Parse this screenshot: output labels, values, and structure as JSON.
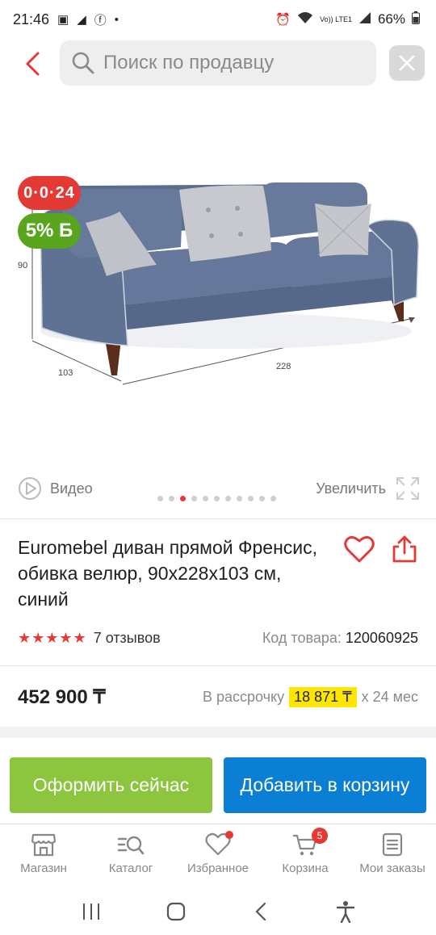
{
  "status": {
    "time": "21:46",
    "battery": "66%",
    "network_label": "Vo)) LTE1"
  },
  "header": {
    "search_placeholder": "Поиск по продавцу"
  },
  "gallery": {
    "badge_installment": "0·0·24",
    "badge_bonus": "5% Б",
    "dim_height": "90",
    "dim_depth": "103",
    "dim_width": "228",
    "video_label": "Видео",
    "zoom_label": "Увеличить",
    "dot_count": 11,
    "active_dot": 2
  },
  "product": {
    "title": "Euromebel диван прямой Френсис, обивка велюр, 90x228x103 см, синий",
    "stars": "★★★★★",
    "reviews": "7 отзывов",
    "sku_label": "Код товара:",
    "sku_value": "120060925",
    "price": "452 900 ₸",
    "installment_label": "В рассрочку",
    "installment_amount": "18 871 ₸",
    "installment_term": "х 24 мес"
  },
  "actions": {
    "checkout": "Оформить сейчас",
    "add_to_cart": "Добавить в корзину"
  },
  "bottom_nav": {
    "items": [
      {
        "label": "Магазин",
        "icon": "shop-icon"
      },
      {
        "label": "Каталог",
        "icon": "catalog-search-icon"
      },
      {
        "label": "Избранное",
        "icon": "heart-icon"
      },
      {
        "label": "Корзина",
        "icon": "cart-icon"
      },
      {
        "label": "Мои заказы",
        "icon": "orders-icon"
      }
    ],
    "cart_count": "5"
  },
  "colors": {
    "accent_red": "#e53935",
    "green": "#8cc63f",
    "blue": "#0b7fd4",
    "highlight_yellow": "#ffe600"
  }
}
